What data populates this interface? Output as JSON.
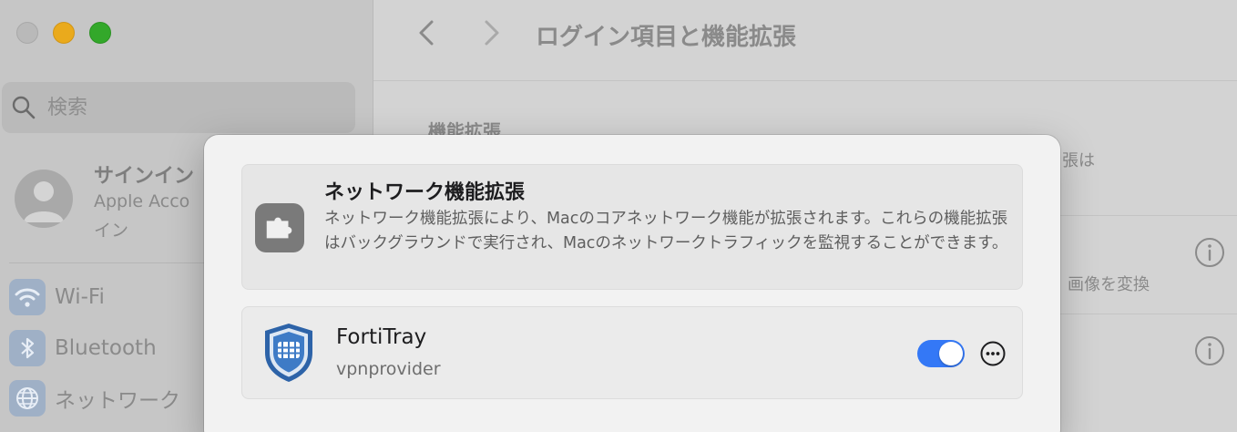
{
  "window": {
    "title": "ログイン項目と機能拡張"
  },
  "sidebar": {
    "search_placeholder": "検索",
    "account": {
      "title": "サインイン",
      "subtitle_line1": "Apple Acco",
      "subtitle_line2": "イン"
    },
    "items": [
      {
        "label": "Wi-Fi",
        "icon": "wifi-icon"
      },
      {
        "label": "Bluetooth",
        "icon": "bluetooth-icon"
      },
      {
        "label": "ネットワーク",
        "icon": "globe-icon"
      }
    ]
  },
  "background": {
    "section_title": "機能拡張",
    "fragment_1": "張は",
    "fragment_2": "画像を変換"
  },
  "sheet": {
    "title": "ネットワーク機能拡張",
    "description": "ネットワーク機能拡張により、Macのコアネットワーク機能が拡張されます。これらの機能拡張はバックグラウンドで実行され、Macのネットワークトラフィックを監視することができます。",
    "extensions": [
      {
        "name": "FortiTray",
        "type": "vpnprovider",
        "enabled": true,
        "icon": "fortitray-shield-icon"
      }
    ]
  },
  "colors": {
    "accent": "#3478f6",
    "traffic_close": "#b9b9b9",
    "traffic_minimize": "#eaaa1c",
    "traffic_maximize": "#33a82a"
  }
}
